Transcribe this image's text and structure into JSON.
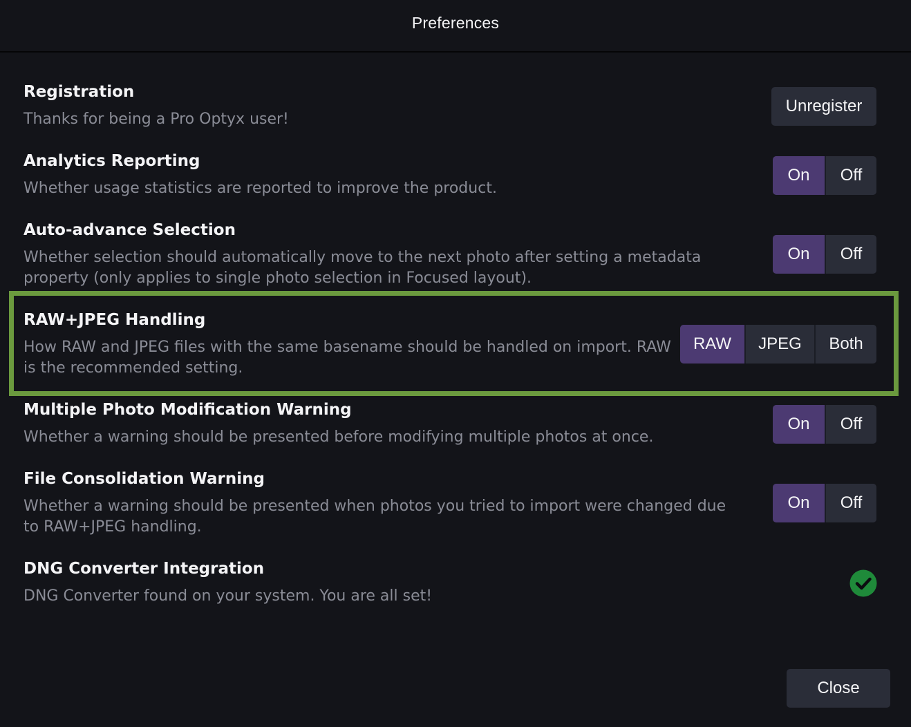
{
  "window": {
    "title": "Preferences"
  },
  "settings": {
    "registration": {
      "title": "Registration",
      "description": "Thanks for being a Pro Optyx user!",
      "button_label": "Unregister"
    },
    "analytics": {
      "title": "Analytics Reporting",
      "description": "Whether usage statistics are reported to improve the product.",
      "options": [
        "On",
        "Off"
      ],
      "selected": "On"
    },
    "auto_advance": {
      "title": "Auto-advance Selection",
      "description": "Whether selection should automatically move to the next photo after setting a metadata property (only applies to single photo selection in Focused layout).",
      "options": [
        "On",
        "Off"
      ],
      "selected": "On"
    },
    "raw_jpeg": {
      "title": "RAW+JPEG Handling",
      "description": "How RAW and JPEG files with the same basename should be handled on import. RAW is the recommended setting.",
      "options": [
        "RAW",
        "JPEG",
        "Both"
      ],
      "selected": "RAW"
    },
    "multi_modify": {
      "title": "Multiple Photo Modification Warning",
      "description": "Whether a warning should be presented before modifying multiple photos at once.",
      "options": [
        "On",
        "Off"
      ],
      "selected": "On"
    },
    "file_consolidation": {
      "title": "File Consolidation Warning",
      "description": "Whether a warning should be presented when photos you tried to import were changed due to RAW+JPEG handling.",
      "options": [
        "On",
        "Off"
      ],
      "selected": "On"
    },
    "dng": {
      "title": "DNG Converter Integration",
      "description": "DNG Converter found on your system. You are all set!",
      "status_icon": "checkmark-circle-icon"
    }
  },
  "footer": {
    "close_label": "Close"
  },
  "colors": {
    "background": "#131419",
    "button": "#2a2d38",
    "active_segment": "#4c3a72",
    "highlight_border": "#6b9a3e",
    "success": "#1f8a3a"
  }
}
